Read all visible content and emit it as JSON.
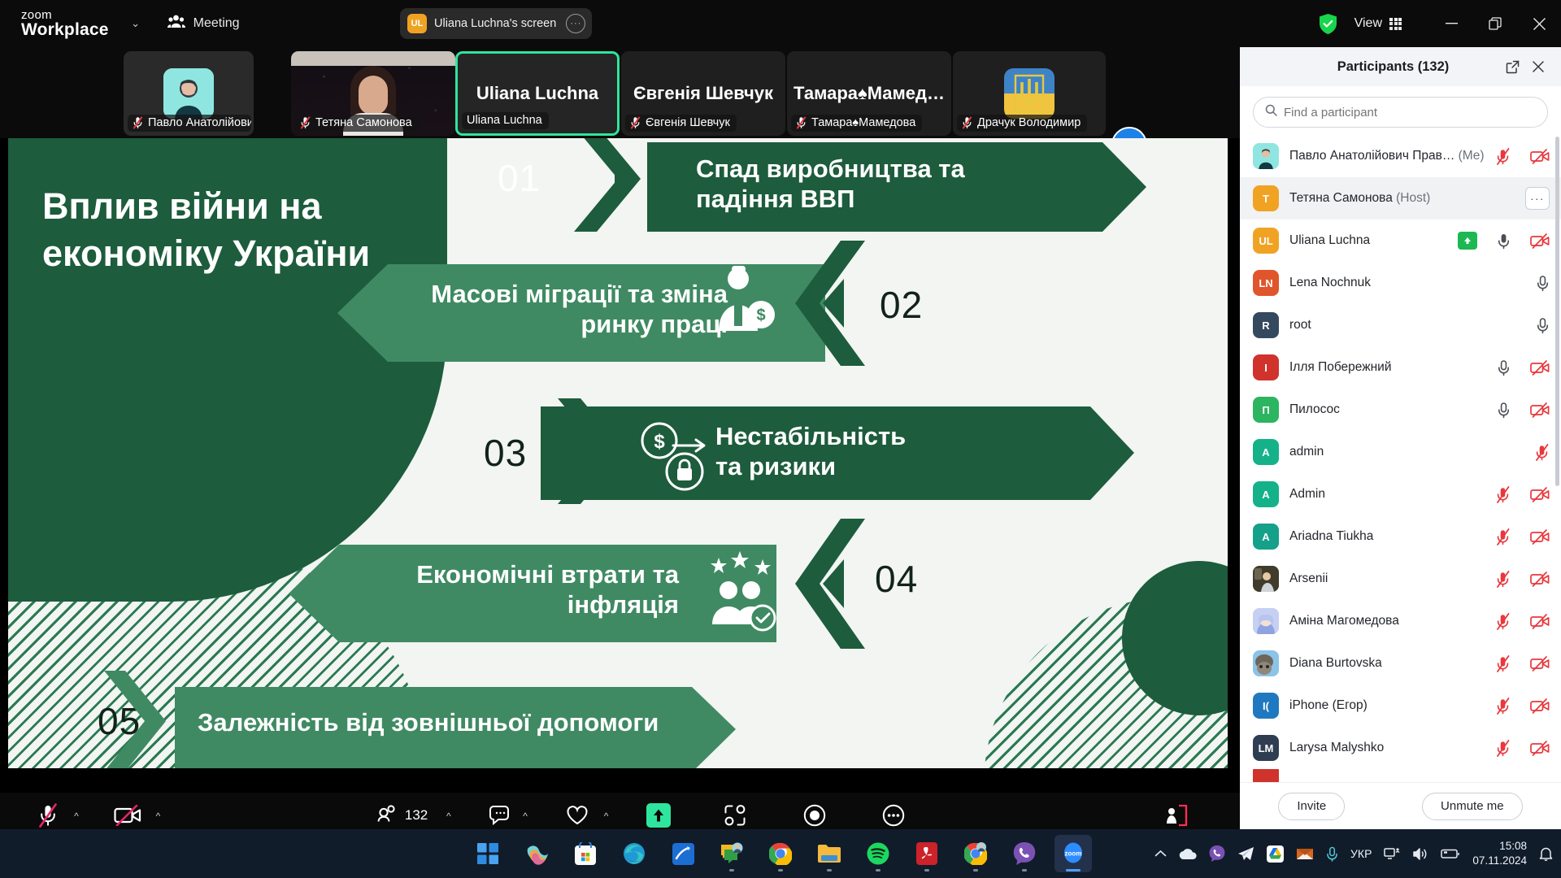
{
  "titlebar": {
    "brand_line1": "zoom",
    "brand_line2": "Workplace",
    "caret": "⌄",
    "meeting_label": "Meeting",
    "sharing_initials": "UL",
    "sharing_label": "Uliana Luchna's screen",
    "sharing_more": "···",
    "view_label": "View",
    "minimize": "—",
    "restore": "❐",
    "close": "✕",
    "shield_icon": "shield-check-icon",
    "grid_icon": "view-grid-icon"
  },
  "thumbstrip": {
    "next_arrow": "›",
    "thumbs": [
      {
        "name": "Павло Анатолійович …",
        "muted": true,
        "active": false,
        "kind": "avatar",
        "color": "#7fe3dd"
      },
      {
        "name": "Тетяна Самонова",
        "muted": true,
        "active": false,
        "kind": "video",
        "color": "#17131c"
      },
      {
        "name": "Uliana Luchna",
        "muted": false,
        "active": true,
        "kind": "bigname",
        "color": "#262626",
        "big": "Uliana Luchna"
      },
      {
        "name": "Євгенія Шевчук",
        "muted": true,
        "active": false,
        "kind": "bigname",
        "color": "#1f1f1f",
        "big": "Євгенія Шевчук"
      },
      {
        "name": "Тамара♠Мамедова",
        "muted": true,
        "active": false,
        "kind": "bigname",
        "color": "#1f1f1f",
        "big": "Тамара♠Мамед…"
      },
      {
        "name": "Драчук Володимир",
        "muted": false,
        "active": false,
        "kind": "flag",
        "color": "#1f1f1f"
      }
    ]
  },
  "slide": {
    "title": "Вплив війни на економіку України",
    "items": [
      {
        "num": "01",
        "text": "Спад виробництва та падіння ВВП",
        "dir": "right",
        "tone": "dark",
        "icon": ""
      },
      {
        "num": "02",
        "text": "Масові міграції та зміна ринку праці",
        "dir": "left",
        "tone": "mid",
        "icon": "worker-dollar-icon"
      },
      {
        "num": "03",
        "text": "Нестабільність та ризики",
        "dir": "right",
        "tone": "dark",
        "icon": "coin-lock-icon"
      },
      {
        "num": "04",
        "text": "Економічні втрати та інфляція",
        "dir": "left",
        "tone": "mid",
        "icon": "people-stars-icon"
      },
      {
        "num": "05",
        "text": "Залежність від зовнішньої допомоги",
        "dir": "right",
        "tone": "mid",
        "icon": ""
      }
    ]
  },
  "toolbar": {
    "buttons": [
      {
        "label": "Audio",
        "icon": "mic-off-icon",
        "caret": true,
        "highlight": false
      },
      {
        "label": "Video",
        "icon": "camera-off-icon",
        "caret": true,
        "highlight": false
      },
      {
        "label": "Participants",
        "icon": "participants-icon",
        "caret": true,
        "highlight": false,
        "badge": "132"
      },
      {
        "label": "Chat",
        "icon": "chat-icon",
        "caret": true,
        "highlight": false
      },
      {
        "label": "React",
        "icon": "heart-icon",
        "caret": true,
        "highlight": false
      },
      {
        "label": "Share",
        "icon": "share-screen-icon",
        "caret": false,
        "highlight": true
      },
      {
        "label": "Apps",
        "icon": "apps-icon",
        "caret": false,
        "highlight": false
      },
      {
        "label": "Record",
        "icon": "record-icon",
        "caret": false,
        "highlight": false
      },
      {
        "label": "More",
        "icon": "more-icon",
        "caret": false,
        "highlight": false
      }
    ],
    "leave_label": "Leave",
    "leave_icon": "leave-door-icon"
  },
  "participants_panel": {
    "title": "Participants (132)",
    "popout_icon": "popout-icon",
    "close_icon": "close-icon",
    "search_placeholder": "Find a participant",
    "search_value": "",
    "search_icon": "search-icon",
    "invite_label": "Invite",
    "unmute_label": "Unmute me",
    "rows": [
      {
        "name": "Павло Анатолійович Прав…",
        "suffix": "(Me)",
        "avatar_kind": "photo",
        "avatar_color": "#8fe6e0",
        "initials": "",
        "selected": false,
        "mic": "muted-red",
        "video": "off-red",
        "more": false,
        "share": false
      },
      {
        "name": "Тетяна Самонова",
        "suffix": "(Host)",
        "avatar_kind": "letter",
        "avatar_color": "#f0a323",
        "initials": "Т",
        "selected": true,
        "mic": "none",
        "video": "none",
        "more": true,
        "share": false
      },
      {
        "name": "Uliana Luchna",
        "suffix": "",
        "avatar_kind": "letter",
        "avatar_color": "#f0a323",
        "initials": "UL",
        "selected": false,
        "mic": "on-grey",
        "video": "off-red",
        "more": false,
        "share": true
      },
      {
        "name": "Lena Nochnuk",
        "suffix": "",
        "avatar_kind": "letter",
        "avatar_color": "#e0552b",
        "initials": "LN",
        "selected": false,
        "mic": "on-grey",
        "video": "none",
        "more": false,
        "share": false
      },
      {
        "name": "root",
        "suffix": "",
        "avatar_kind": "letter",
        "avatar_color": "#35495e",
        "initials": "R",
        "selected": false,
        "mic": "on-grey",
        "video": "none",
        "more": false,
        "share": false
      },
      {
        "name": "Ілля Побережний",
        "suffix": "",
        "avatar_kind": "letter",
        "avatar_color": "#d0332c",
        "initials": "І",
        "selected": false,
        "mic": "on-grey",
        "video": "off-red",
        "more": false,
        "share": false
      },
      {
        "name": "Пилосос",
        "suffix": "",
        "avatar_kind": "letter",
        "avatar_color": "#2bb561",
        "initials": "П",
        "selected": false,
        "mic": "on-grey",
        "video": "off-red",
        "more": false,
        "share": false
      },
      {
        "name": "admin",
        "suffix": "",
        "avatar_kind": "letter",
        "avatar_color": "#15b28a",
        "initials": "A",
        "selected": false,
        "mic": "muted-red",
        "video": "none",
        "more": false,
        "share": false
      },
      {
        "name": "Admin",
        "suffix": "",
        "avatar_kind": "letter",
        "avatar_color": "#15b28a",
        "initials": "A",
        "selected": false,
        "mic": "muted-red",
        "video": "off-red",
        "more": false,
        "share": false
      },
      {
        "name": "Ariadna Tiukha",
        "suffix": "",
        "avatar_kind": "letter",
        "avatar_color": "#15a08a",
        "initials": "A",
        "selected": false,
        "mic": "muted-red",
        "video": "off-red",
        "more": false,
        "share": false
      },
      {
        "name": "Arsenii",
        "suffix": "",
        "avatar_kind": "photo",
        "avatar_color": "#4b4434",
        "initials": "",
        "selected": false,
        "mic": "muted-red",
        "video": "off-red",
        "more": false,
        "share": false
      },
      {
        "name": "Аміна Магомедова",
        "suffix": "",
        "avatar_kind": "photo",
        "avatar_color": "#b9c6ef",
        "initials": "",
        "selected": false,
        "mic": "muted-red",
        "video": "off-red",
        "more": false,
        "share": false
      },
      {
        "name": "Diana Burtovska",
        "suffix": "",
        "avatar_kind": "photo",
        "avatar_color": "#7fb4d8",
        "initials": "",
        "selected": false,
        "mic": "muted-red",
        "video": "off-red",
        "more": false,
        "share": false
      },
      {
        "name": "iPhone (Егор)",
        "suffix": "",
        "avatar_kind": "letter",
        "avatar_color": "#2079c0",
        "initials": "I(",
        "selected": false,
        "mic": "muted-red",
        "video": "off-red",
        "more": false,
        "share": false
      },
      {
        "name": "Larysa Malyshko",
        "suffix": "",
        "avatar_kind": "letter",
        "avatar_color": "#2f3d52",
        "initials": "LM",
        "selected": false,
        "mic": "muted-red",
        "video": "off-red",
        "more": false,
        "share": false
      },
      {
        "name": "",
        "suffix": "",
        "avatar_kind": "letter",
        "avatar_color": "#d0332c",
        "initials": "",
        "selected": false,
        "mic": "none",
        "video": "none",
        "more": false,
        "share": false
      }
    ]
  },
  "taskbar": {
    "apps": [
      {
        "name": "start-button",
        "running": false
      },
      {
        "name": "copilot-icon",
        "running": false
      },
      {
        "name": "microsoft-store-icon",
        "running": false
      },
      {
        "name": "edge-icon",
        "running": false
      },
      {
        "name": "onenote-icon",
        "running": false
      },
      {
        "name": "messenger-icon",
        "running": true
      },
      {
        "name": "chrome-icon",
        "running": true
      },
      {
        "name": "file-explorer-icon",
        "running": true
      },
      {
        "name": "spotify-icon",
        "running": true
      },
      {
        "name": "acrobat-icon",
        "running": true
      },
      {
        "name": "chrome-2-icon",
        "running": true
      },
      {
        "name": "viber-icon",
        "running": true
      },
      {
        "name": "zoom-icon",
        "running": true,
        "active": true,
        "label": "zoom"
      }
    ],
    "tray": [
      {
        "name": "show-hidden-icons",
        "glyph": "^"
      },
      {
        "name": "onedrive-icon"
      },
      {
        "name": "viber-tray-icon"
      },
      {
        "name": "telegram-icon"
      },
      {
        "name": "google-drive-icon"
      },
      {
        "name": "mail-tray-icon"
      },
      {
        "name": "microphone-tray-icon"
      }
    ],
    "language": "УКР",
    "network_icon": "network-icon",
    "volume_icon": "volume-icon",
    "battery_icon": "battery-icon",
    "time": "15:08",
    "date": "07.11.2024",
    "notification_icon": "bell-icon"
  },
  "colors": {
    "accent_green": "#2ee59d",
    "slide_dark": "#1d5c3c",
    "slide_mid": "#3f8a63",
    "zoom_blue": "#1c82e8",
    "mute_red": "#e8383d",
    "taskbar_bg": "#111c2b"
  }
}
